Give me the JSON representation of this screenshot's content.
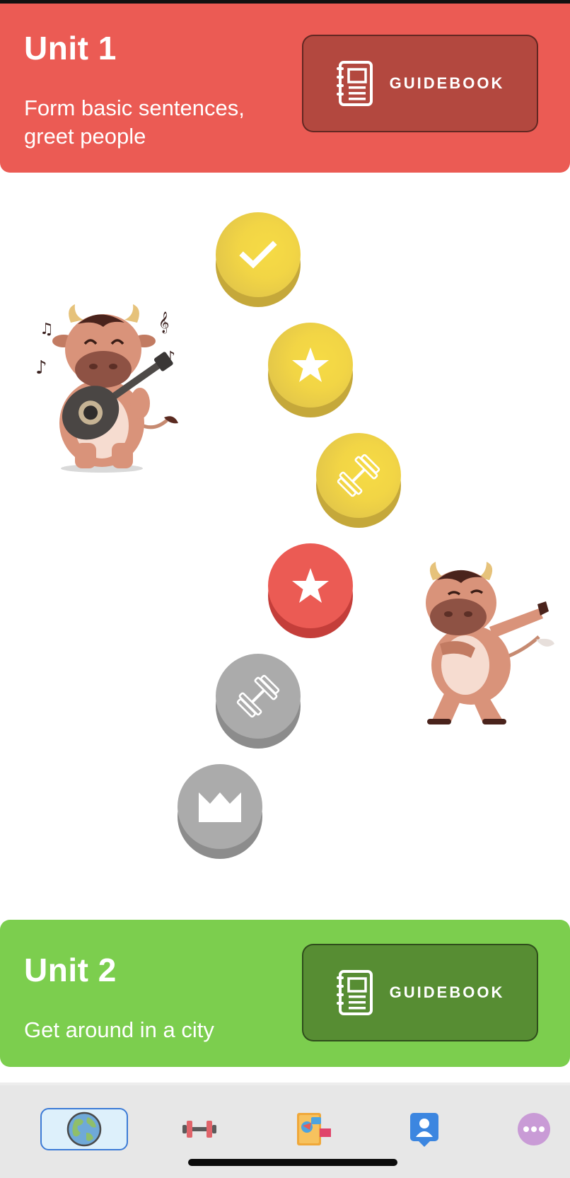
{
  "units": [
    {
      "title": "Unit 1",
      "description": "Form basic sentences, greet people",
      "guidebook_label": "GUIDEBOOK",
      "color": "#EB5B54",
      "button_color": "#B3483F"
    },
    {
      "title": "Unit 2",
      "description": "Get around in a city",
      "guidebook_label": "GUIDEBOOK",
      "color": "#7CCE4E",
      "button_color": "#578D33"
    }
  ],
  "path_nodes": [
    {
      "icon": "check-icon",
      "state": "completed",
      "color": "#F2D545"
    },
    {
      "icon": "star-icon",
      "state": "completed",
      "color": "#F2D545"
    },
    {
      "icon": "dumbbell-icon",
      "state": "completed",
      "color": "#F2D545"
    },
    {
      "icon": "star-icon",
      "state": "current",
      "color": "#EB5B54"
    },
    {
      "icon": "dumbbell-icon",
      "state": "locked",
      "color": "#ABABAB"
    },
    {
      "icon": "crown-icon",
      "state": "locked",
      "color": "#ABABAB"
    }
  ],
  "tabs": [
    {
      "icon": "globe-icon",
      "active": true
    },
    {
      "icon": "dumbbell-tab-icon",
      "active": false
    },
    {
      "icon": "notebook-icon",
      "active": false
    },
    {
      "icon": "profile-icon",
      "active": false
    },
    {
      "icon": "more-icon",
      "active": false
    }
  ]
}
